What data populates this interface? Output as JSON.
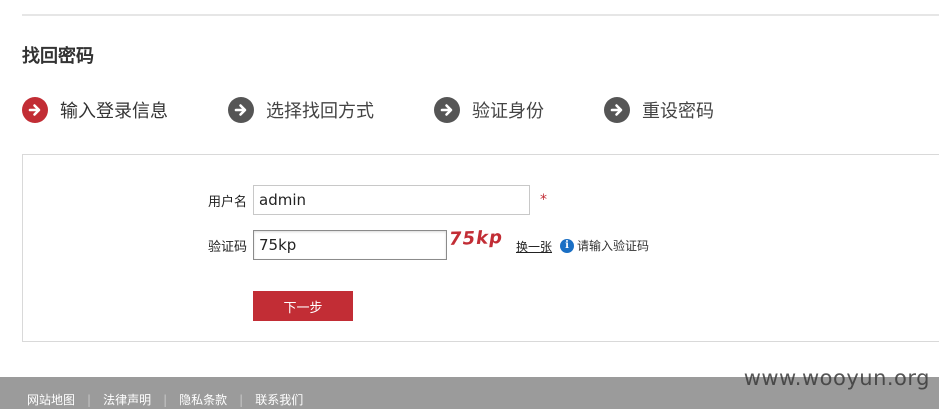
{
  "page": {
    "title": "找回密码"
  },
  "steps": [
    {
      "label": "输入登录信息",
      "active": true
    },
    {
      "label": "选择找回方式",
      "active": false
    },
    {
      "label": "验证身份",
      "active": false
    },
    {
      "label": "重设密码",
      "active": false
    }
  ],
  "form": {
    "username": {
      "label": "用户名",
      "value": "admin",
      "required_mark": "*"
    },
    "captcha": {
      "label": "验证码",
      "value": "75kp",
      "image_text": "75kp",
      "swap_link": "换一张",
      "hint_icon": "i",
      "hint": "请输入验证码"
    },
    "next_button": "下一步"
  },
  "footer": {
    "links": [
      "网站地图",
      "法律声明",
      "隐私条款",
      "联系我们"
    ],
    "separator": "|"
  },
  "watermark": "www.wooyun.org",
  "colors": {
    "accent": "#c22d35",
    "step_inactive": "#555555",
    "footer_bg": "#9b9b9b",
    "info_blue": "#1a6fc4"
  },
  "icons": {
    "step": "arrow-right-circle-icon",
    "hint": "info-icon"
  }
}
